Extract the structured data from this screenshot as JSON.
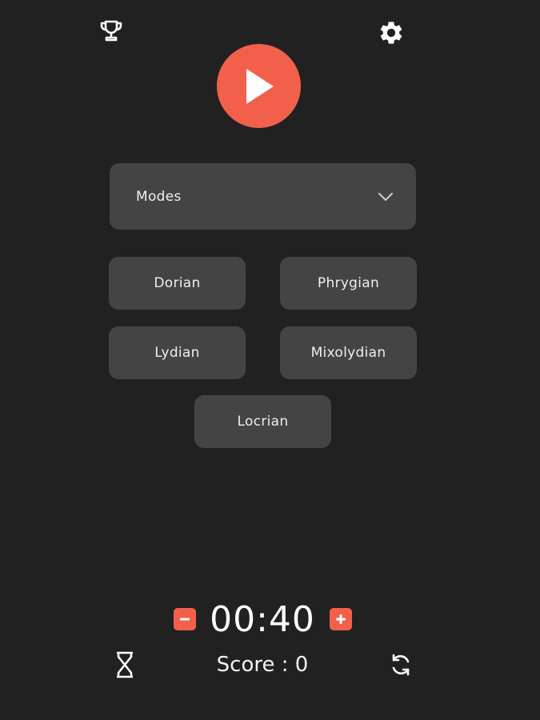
{
  "header": {
    "leaderboard_icon": "trophy-icon",
    "settings_icon": "gear-icon"
  },
  "play_button": {
    "icon": "play-icon",
    "color": "#f2604c"
  },
  "category_select": {
    "selected": "Modes",
    "icon": "chevron-down-icon"
  },
  "options": [
    "Dorian",
    "Phrygian",
    "Lydian",
    "Mixolydian",
    "Locrian"
  ],
  "timer": {
    "value": "00:40",
    "decrease_icon": "minus-icon",
    "increase_icon": "plus-icon"
  },
  "footer": {
    "timer_mode_icon": "hourglass-icon",
    "score_text": "Score : 0",
    "restart_icon": "refresh-icon"
  },
  "colors": {
    "background": "#212121",
    "card": "#444444",
    "accent": "#f2604c"
  }
}
